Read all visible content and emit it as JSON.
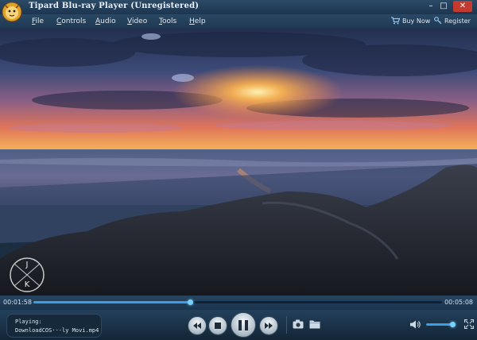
{
  "window": {
    "title": "Tipard Blu-ray Player (Unregistered)",
    "buttons": [
      "–",
      "□",
      "✕"
    ]
  },
  "menu": {
    "items": [
      {
        "key": "F",
        "rest": "ile"
      },
      {
        "key": "C",
        "rest": "ontrols"
      },
      {
        "key": "A",
        "rest": "udio"
      },
      {
        "key": "V",
        "rest": "ideo"
      },
      {
        "key": "T",
        "rest": "ools"
      },
      {
        "key": "H",
        "rest": "elp"
      }
    ],
    "buy_now": "Buy Now",
    "register": "Register"
  },
  "video": {
    "watermark_letters": [
      "J",
      "K"
    ]
  },
  "seek": {
    "current_time": "00:01:58",
    "total_time": "00:05:08",
    "progress": 0.383
  },
  "now_playing": {
    "label": "Playing:",
    "file": "DownloadCOS···ly Movi.mp4"
  },
  "volume": {
    "level": 0.95
  },
  "colors": {
    "accent": "#3d9ee6",
    "chrome": "#1e3852"
  },
  "icons": {
    "prev": "previous-icon",
    "stop": "stop-icon",
    "pause": "pause-icon",
    "next": "next-icon",
    "snapshot": "camera-icon",
    "open": "folder-icon",
    "volume": "speaker-icon",
    "fullscreen": "fullscreen-icon",
    "cart": "cart-icon",
    "register": "key-icon"
  }
}
